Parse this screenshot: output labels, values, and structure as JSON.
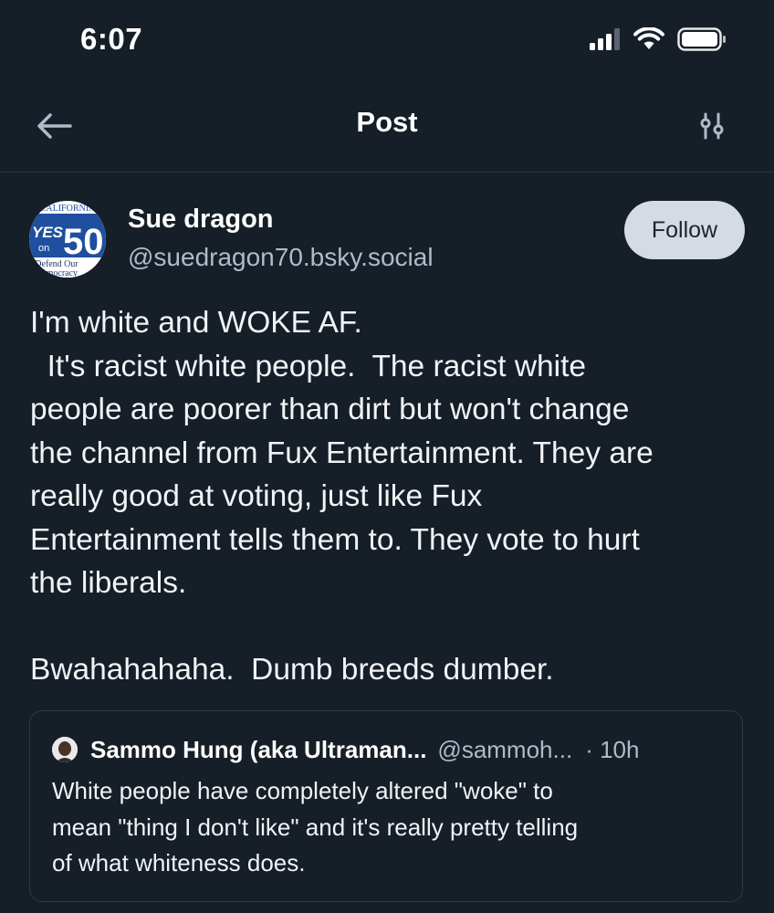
{
  "status_bar": {
    "time": "6:07",
    "icons": [
      "cellular-signal-icon",
      "wifi-icon",
      "battery-icon"
    ]
  },
  "header": {
    "title": "Post",
    "back_icon": "arrow-left-icon",
    "settings_icon": "sliders-icon"
  },
  "author": {
    "name": "Sue dragon",
    "handle": "@suedragon70.bsky.social",
    "avatar_text": {
      "top": "CALIFORNIA",
      "yes": "YES",
      "on": "on",
      "number": "50",
      "bottom1": "Defend Our",
      "bottom2": "Democracy"
    },
    "follow_label": "Follow"
  },
  "post": {
    "lines": [
      "I'm white and WOKE AF.",
      "  It's racist white people.  The racist white",
      "people are poorer than dirt but won't change",
      "the channel from Fux Entertainment. They are",
      "really good at voting, just like Fux",
      "Entertainment tells them to. They vote to hurt",
      "the liberals.",
      "",
      "Bwahahahaha.  Dumb breeds dumber."
    ]
  },
  "quote": {
    "author_name": "Sammo Hung (aka Ultraman...",
    "author_handle": "@sammoh...",
    "time": "· 10h",
    "lines": [
      "White people have completely altered \"woke\" to",
      "mean \"thing I don't like\" and it's really pretty telling",
      "of what whiteness does."
    ]
  },
  "colors": {
    "background": "#161e27",
    "text": "#f1f3f5",
    "muted": "#aebbc9",
    "follow_button": "#d4dbe2",
    "divider": "#2b3641",
    "avatar_blue": "#1f4f9e"
  }
}
